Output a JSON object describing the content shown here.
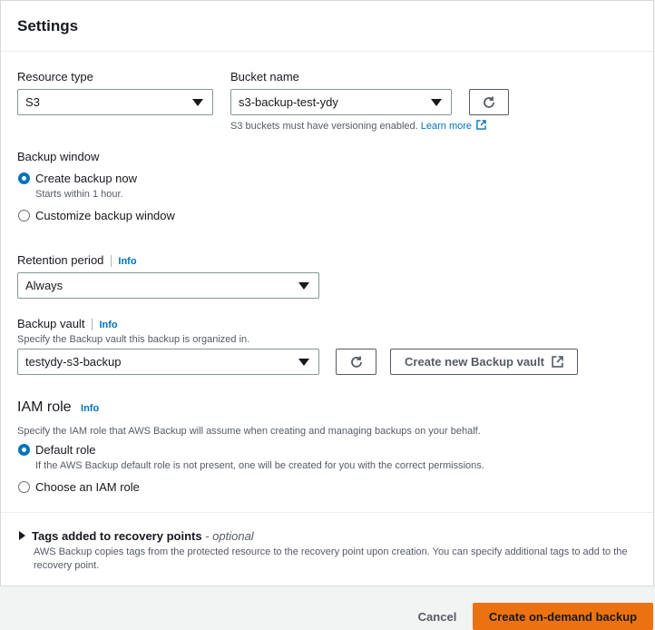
{
  "settings": {
    "title": "Settings",
    "resource_type": {
      "label": "Resource type",
      "value": "S3"
    },
    "bucket": {
      "label": "Bucket name",
      "value": "s3-backup-test-ydy",
      "hint": "S3 buckets must have versioning enabled.",
      "learn_more": "Learn more"
    },
    "backup_window": {
      "label": "Backup window",
      "options": [
        {
          "label": "Create backup now",
          "desc": "Starts within 1 hour.",
          "selected": true
        },
        {
          "label": "Customize backup window",
          "selected": false
        }
      ]
    },
    "retention": {
      "label": "Retention period",
      "info": "Info",
      "value": "Always"
    },
    "vault": {
      "label": "Backup vault",
      "info": "Info",
      "desc": "Specify the Backup vault this backup is organized in.",
      "value": "testydy-s3-backup",
      "create_label": "Create new Backup vault"
    },
    "iam": {
      "label": "IAM role",
      "info": "Info",
      "desc": "Specify the IAM role that AWS Backup will assume when creating and managing backups on your behalf.",
      "options": [
        {
          "label": "Default role",
          "desc": "If the AWS Backup default role is not present, one will be created for you with the correct permissions.",
          "selected": true
        },
        {
          "label": "Choose an IAM role",
          "selected": false
        }
      ]
    },
    "tags": {
      "title": "Tags added to recovery points",
      "optional": "- optional",
      "desc_line1": "AWS Backup copies tags from the protected resource to the recovery point upon creation. You can specify additional tags to add to the",
      "desc_line2": "recovery point."
    }
  },
  "footer": {
    "cancel": "Cancel",
    "submit": "Create on-demand backup"
  },
  "colors": {
    "accent": "#0073bb",
    "primary_button": "#ec7211"
  }
}
